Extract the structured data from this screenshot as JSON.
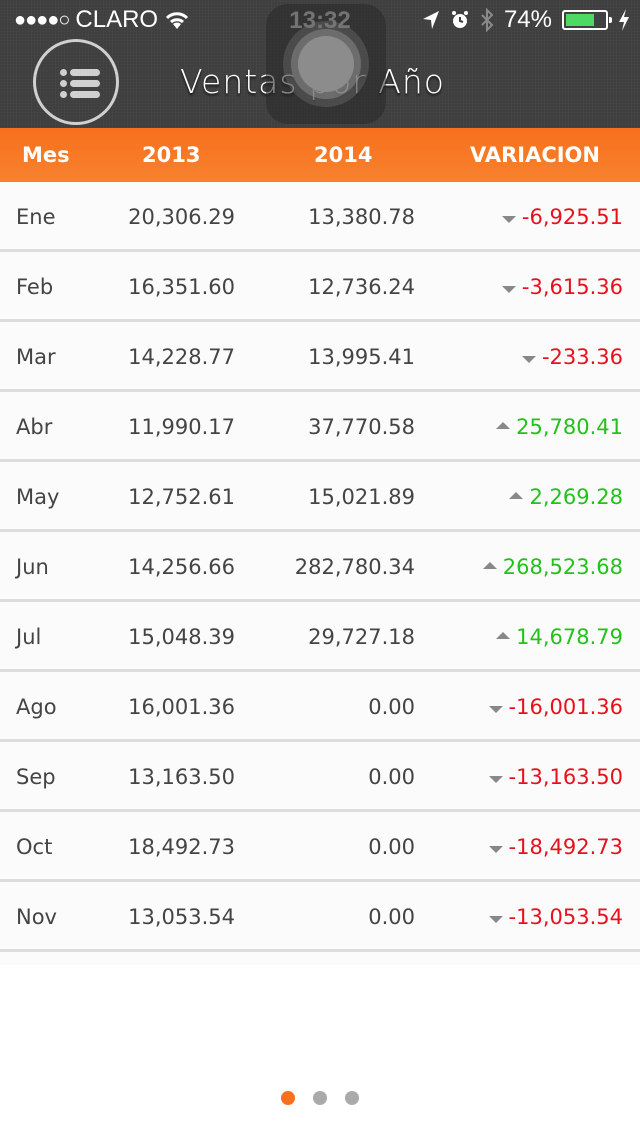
{
  "status_bar": {
    "signal": "●●●●○",
    "carrier": "CLARO",
    "time": "13:32",
    "battery_percent_label": "74%",
    "battery_level": 0.74,
    "battery_color": "#4cd964"
  },
  "header": {
    "title": "Ventas por Año",
    "menu_icon": "list-icon"
  },
  "table": {
    "columns": [
      "Mes",
      "2013",
      "2014",
      "VARIACION"
    ],
    "rows": [
      {
        "mes": "Ene",
        "y2013": "20,306.29",
        "y2014": "13,380.78",
        "variacion": "-6,925.51",
        "trend": "down"
      },
      {
        "mes": "Feb",
        "y2013": "16,351.60",
        "y2014": "12,736.24",
        "variacion": "-3,615.36",
        "trend": "down"
      },
      {
        "mes": "Mar",
        "y2013": "14,228.77",
        "y2014": "13,995.41",
        "variacion": "-233.36",
        "trend": "down"
      },
      {
        "mes": "Abr",
        "y2013": "11,990.17",
        "y2014": "37,770.58",
        "variacion": "25,780.41",
        "trend": "up"
      },
      {
        "mes": "May",
        "y2013": "12,752.61",
        "y2014": "15,021.89",
        "variacion": "2,269.28",
        "trend": "up"
      },
      {
        "mes": "Jun",
        "y2013": "14,256.66",
        "y2014": "282,780.34",
        "variacion": "268,523.68",
        "trend": "up"
      },
      {
        "mes": "Jul",
        "y2013": "15,048.39",
        "y2014": "29,727.18",
        "variacion": "14,678.79",
        "trend": "up"
      },
      {
        "mes": "Ago",
        "y2013": "16,001.36",
        "y2014": "0.00",
        "variacion": "-16,001.36",
        "trend": "down"
      },
      {
        "mes": "Sep",
        "y2013": "13,163.50",
        "y2014": "0.00",
        "variacion": "-13,163.50",
        "trend": "down"
      },
      {
        "mes": "Oct",
        "y2013": "18,492.73",
        "y2014": "0.00",
        "variacion": "-18,492.73",
        "trend": "down"
      },
      {
        "mes": "Nov",
        "y2013": "13,053.54",
        "y2014": "0.00",
        "variacion": "-13,053.54",
        "trend": "down"
      }
    ]
  },
  "colors": {
    "accent": "#f86f1c",
    "negative": "#e8101c",
    "positive": "#22c21a"
  },
  "pager": {
    "pages": 3,
    "active_index": 0
  }
}
